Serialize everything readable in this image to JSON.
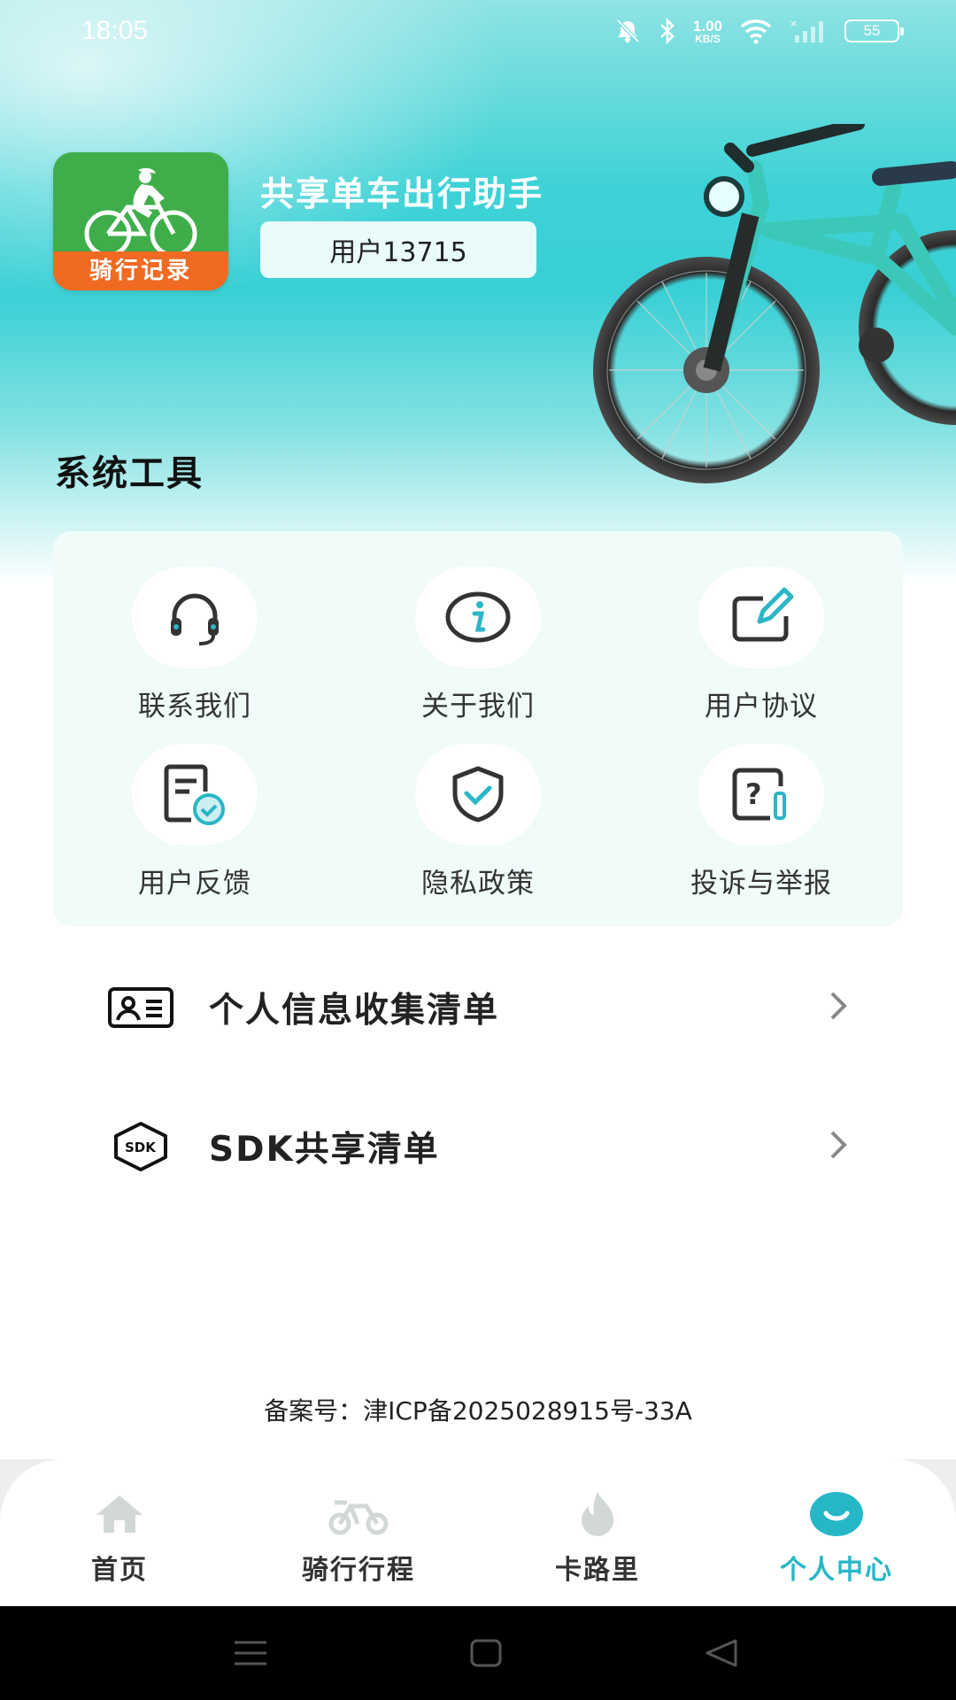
{
  "status_bar": {
    "time": "18:05",
    "net_speed_value": "1.00",
    "net_speed_unit": "KB/S",
    "battery_level": "55",
    "icons": [
      "mute-icon",
      "bluetooth-icon",
      "wifi-icon",
      "signal-icon"
    ]
  },
  "header": {
    "app_logo_text": "骑行记录",
    "app_name": "共享单车出行助手",
    "user_label": "用户13715"
  },
  "section_title": "系统工具",
  "tools": [
    {
      "label": "联系我们",
      "icon": "headset-icon"
    },
    {
      "label": "关于我们",
      "icon": "info-icon"
    },
    {
      "label": "用户协议",
      "icon": "edit-icon"
    },
    {
      "label": "用户反馈",
      "icon": "feedback-icon"
    },
    {
      "label": "隐私政策",
      "icon": "shield-icon"
    },
    {
      "label": "投诉与举报",
      "icon": "report-icon"
    }
  ],
  "list": [
    {
      "label": "个人信息收集清单",
      "icon": "id-card-icon"
    },
    {
      "label": "SDK共享清单",
      "icon": "sdk-icon"
    }
  ],
  "icp": "备案号：津ICP备2025028915号-33A",
  "nav": [
    {
      "label": "首页",
      "icon": "home-icon"
    },
    {
      "label": "骑行行程",
      "icon": "bike-icon"
    },
    {
      "label": "卡路里",
      "icon": "flame-icon"
    },
    {
      "label": "个人中心",
      "icon": "profile-icon",
      "active": true
    }
  ],
  "colors": {
    "accent": "#26b7c7",
    "header_teal": "#38d0d5",
    "logo_green": "#3fae4a",
    "logo_orange": "#f06a21",
    "card_bg": "#f0fbfa"
  }
}
